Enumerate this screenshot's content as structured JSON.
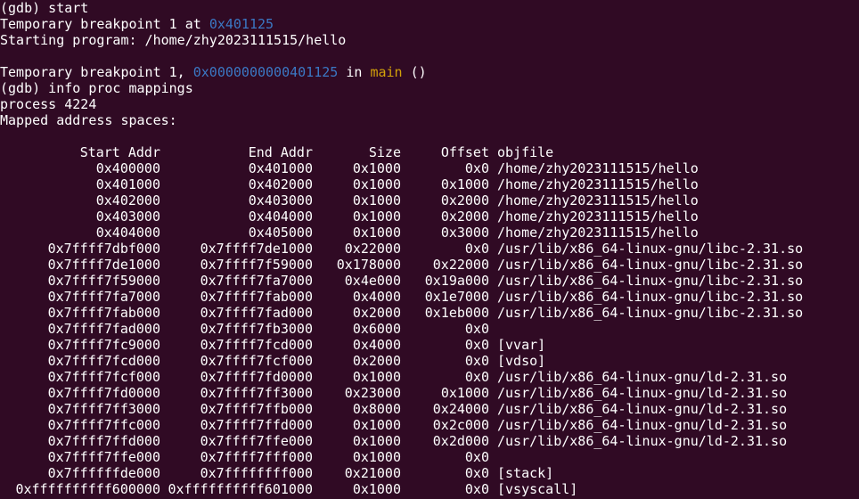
{
  "terminal": {
    "prompt_start": "(gdb) start",
    "bp_prefix": "Temporary breakpoint 1 at ",
    "bp_addr": "0x401125",
    "starting": "Starting program: /home/zhy2023111515/hello",
    "hit_prefix": "Temporary breakpoint 1, ",
    "hit_addr": "0x0000000000401125",
    "hit_in": " in ",
    "hit_func": "main",
    "hit_args": " ()",
    "prompt_mappings": "(gdb) info proc mappings",
    "process": "process 4224",
    "mapped": "Mapped address spaces:"
  },
  "table": {
    "headers": {
      "start": "Start Addr",
      "end": "End Addr",
      "size": "Size",
      "offset": "Offset",
      "objfile": "objfile"
    },
    "rows": [
      {
        "start": "0x400000",
        "end": "0x401000",
        "size": "0x1000",
        "offset": "0x0",
        "objfile": "/home/zhy2023111515/hello"
      },
      {
        "start": "0x401000",
        "end": "0x402000",
        "size": "0x1000",
        "offset": "0x1000",
        "objfile": "/home/zhy2023111515/hello"
      },
      {
        "start": "0x402000",
        "end": "0x403000",
        "size": "0x1000",
        "offset": "0x2000",
        "objfile": "/home/zhy2023111515/hello"
      },
      {
        "start": "0x403000",
        "end": "0x404000",
        "size": "0x1000",
        "offset": "0x2000",
        "objfile": "/home/zhy2023111515/hello"
      },
      {
        "start": "0x404000",
        "end": "0x405000",
        "size": "0x1000",
        "offset": "0x3000",
        "objfile": "/home/zhy2023111515/hello"
      },
      {
        "start": "0x7ffff7dbf000",
        "end": "0x7ffff7de1000",
        "size": "0x22000",
        "offset": "0x0",
        "objfile": "/usr/lib/x86_64-linux-gnu/libc-2.31.so"
      },
      {
        "start": "0x7ffff7de1000",
        "end": "0x7ffff7f59000",
        "size": "0x178000",
        "offset": "0x22000",
        "objfile": "/usr/lib/x86_64-linux-gnu/libc-2.31.so"
      },
      {
        "start": "0x7ffff7f59000",
        "end": "0x7ffff7fa7000",
        "size": "0x4e000",
        "offset": "0x19a000",
        "objfile": "/usr/lib/x86_64-linux-gnu/libc-2.31.so"
      },
      {
        "start": "0x7ffff7fa7000",
        "end": "0x7ffff7fab000",
        "size": "0x4000",
        "offset": "0x1e7000",
        "objfile": "/usr/lib/x86_64-linux-gnu/libc-2.31.so"
      },
      {
        "start": "0x7ffff7fab000",
        "end": "0x7ffff7fad000",
        "size": "0x2000",
        "offset": "0x1eb000",
        "objfile": "/usr/lib/x86_64-linux-gnu/libc-2.31.so"
      },
      {
        "start": "0x7ffff7fad000",
        "end": "0x7ffff7fb3000",
        "size": "0x6000",
        "offset": "0x0",
        "objfile": ""
      },
      {
        "start": "0x7ffff7fc9000",
        "end": "0x7ffff7fcd000",
        "size": "0x4000",
        "offset": "0x0",
        "objfile": "[vvar]"
      },
      {
        "start": "0x7ffff7fcd000",
        "end": "0x7ffff7fcf000",
        "size": "0x2000",
        "offset": "0x0",
        "objfile": "[vdso]"
      },
      {
        "start": "0x7ffff7fcf000",
        "end": "0x7ffff7fd0000",
        "size": "0x1000",
        "offset": "0x0",
        "objfile": "/usr/lib/x86_64-linux-gnu/ld-2.31.so"
      },
      {
        "start": "0x7ffff7fd0000",
        "end": "0x7ffff7ff3000",
        "size": "0x23000",
        "offset": "0x1000",
        "objfile": "/usr/lib/x86_64-linux-gnu/ld-2.31.so"
      },
      {
        "start": "0x7ffff7ff3000",
        "end": "0x7ffff7ffb000",
        "size": "0x8000",
        "offset": "0x24000",
        "objfile": "/usr/lib/x86_64-linux-gnu/ld-2.31.so"
      },
      {
        "start": "0x7ffff7ffc000",
        "end": "0x7ffff7ffd000",
        "size": "0x1000",
        "offset": "0x2c000",
        "objfile": "/usr/lib/x86_64-linux-gnu/ld-2.31.so"
      },
      {
        "start": "0x7ffff7ffd000",
        "end": "0x7ffff7ffe000",
        "size": "0x1000",
        "offset": "0x2d000",
        "objfile": "/usr/lib/x86_64-linux-gnu/ld-2.31.so"
      },
      {
        "start": "0x7ffff7ffe000",
        "end": "0x7ffff7fff000",
        "size": "0x1000",
        "offset": "0x0",
        "objfile": ""
      },
      {
        "start": "0x7ffffffde000",
        "end": "0x7ffffffff000",
        "size": "0x21000",
        "offset": "0x0",
        "objfile": "[stack]"
      },
      {
        "start": "0xffffffffff600000",
        "end": "0xffffffffff601000",
        "size": "0x1000",
        "offset": "0x0",
        "objfile": "[vsyscall]"
      }
    ]
  },
  "colors": {
    "background": "#300a24",
    "text": "#ffffff",
    "address": "#3b78c4",
    "function": "#d3a20a"
  }
}
